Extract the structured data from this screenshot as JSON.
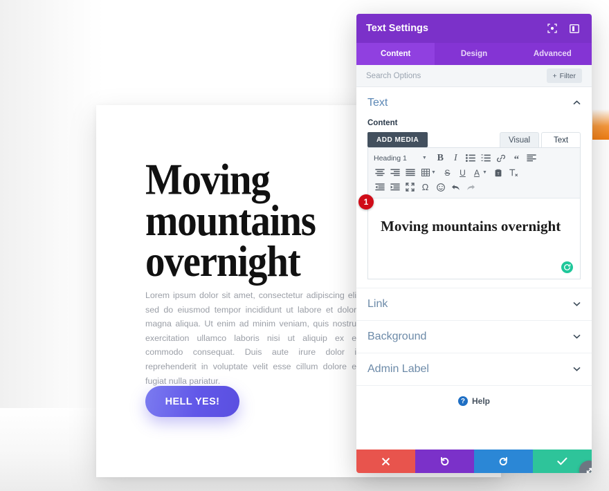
{
  "page": {
    "hero": {
      "heading": "Moving mountains overnight",
      "paragraph": "Lorem ipsum dolor sit amet, consectetur adipiscing elit, sed do eiusmod tempor incididunt ut labore et dolore magna aliqua. Ut enim ad minim veniam, quis nostrud exercitation ullamco laboris nisi ut aliquip ex ea commodo consequat. Duis aute irure dolor in reprehenderit in voluptate velit esse cillum dolore eu fugiat nulla pariatur.",
      "cta_label": "HELL YES!"
    }
  },
  "modal": {
    "title": "Text Settings",
    "header_icons": [
      {
        "name": "focus-icon",
        "glyph": "☉"
      },
      {
        "name": "layout-columns-icon",
        "glyph": "▣"
      }
    ],
    "tabs": [
      {
        "label": "Content",
        "active": true
      },
      {
        "label": "Design",
        "active": false
      },
      {
        "label": "Advanced",
        "active": false
      }
    ],
    "search": {
      "value": "",
      "placeholder": "Search Options"
    },
    "filter_label": "Filter",
    "filter_plus": "+",
    "sections": [
      {
        "label": "Text",
        "open": true,
        "chevron": "⌃"
      },
      {
        "label": "Link",
        "open": false,
        "chevron": "⌄"
      },
      {
        "label": "Background",
        "open": false,
        "chevron": "⌄"
      },
      {
        "label": "Admin Label",
        "open": false,
        "chevron": "⌄"
      }
    ],
    "content_field": {
      "label": "Content",
      "add_media_label": "ADD MEDIA",
      "editor_tabs": [
        {
          "label": "Visual",
          "active": false
        },
        {
          "label": "Text",
          "active": true
        }
      ],
      "format_select": "Heading 1",
      "toolbar_row1": [
        {
          "name": "bold-icon",
          "glyph": "B",
          "style": "bold-serif"
        },
        {
          "name": "italic-icon",
          "glyph": "I",
          "style": "italic-serif"
        },
        {
          "name": "unordered-list-icon",
          "glyph": "☰",
          "style": "list"
        },
        {
          "name": "ordered-list-icon",
          "glyph": "☲",
          "style": "list"
        },
        {
          "name": "link-icon",
          "glyph": "⚭",
          "style": "plain"
        },
        {
          "name": "blockquote-icon",
          "glyph": "“",
          "style": "quote"
        },
        {
          "name": "align-left-icon",
          "glyph": "≡",
          "style": "plain"
        }
      ],
      "toolbar_row2": [
        {
          "name": "align-center-icon",
          "glyph": "≡"
        },
        {
          "name": "align-right-icon",
          "glyph": "≡"
        },
        {
          "name": "justify-icon",
          "glyph": "≡"
        },
        {
          "name": "table-icon",
          "glyph": "⊞"
        },
        {
          "name": "strikethrough-icon",
          "glyph": "S"
        },
        {
          "name": "underline-icon",
          "glyph": "U"
        },
        {
          "name": "text-color-icon",
          "glyph": "A"
        },
        {
          "name": "paste-as-text-icon",
          "glyph": "ὌB"
        },
        {
          "name": "clear-formatting-icon",
          "glyph": "T"
        }
      ],
      "toolbar_row3": [
        {
          "name": "outdent-icon",
          "glyph": "⇤"
        },
        {
          "name": "indent-icon",
          "glyph": "⇥"
        },
        {
          "name": "fullscreen-icon",
          "glyph": "⤡"
        },
        {
          "name": "special-character-icon",
          "glyph": "Ω"
        },
        {
          "name": "emoji-icon",
          "glyph": "☺"
        },
        {
          "name": "undo-icon",
          "glyph": "↶"
        },
        {
          "name": "redo-icon",
          "glyph": "↷"
        }
      ],
      "editor_text": "Moving mountains overnight",
      "badge_number": "1",
      "refresh_glyph": "↻"
    },
    "help_label": "Help",
    "help_glyph": "?",
    "footer_buttons": [
      {
        "name": "cancel-button",
        "glyph": "✖",
        "color": "#e8544d"
      },
      {
        "name": "undo-button",
        "glyph": "↺",
        "color": "#7b31c9"
      },
      {
        "name": "redo-button",
        "glyph": "↻",
        "color": "#2b87d6"
      },
      {
        "name": "save-button",
        "glyph": "✔",
        "color": "#2ec49a"
      }
    ],
    "resize_glyph": "⤡"
  },
  "colors": {
    "purple_header": "#7b31c9",
    "purple_tabs": "#8434d4",
    "accent_red": "#d00c18",
    "accent_green": "#1fc79a",
    "cta_gradient_start": "#7b7bf0",
    "cta_gradient_end": "#5a4fe0",
    "orange_strip": "#f07d14"
  }
}
